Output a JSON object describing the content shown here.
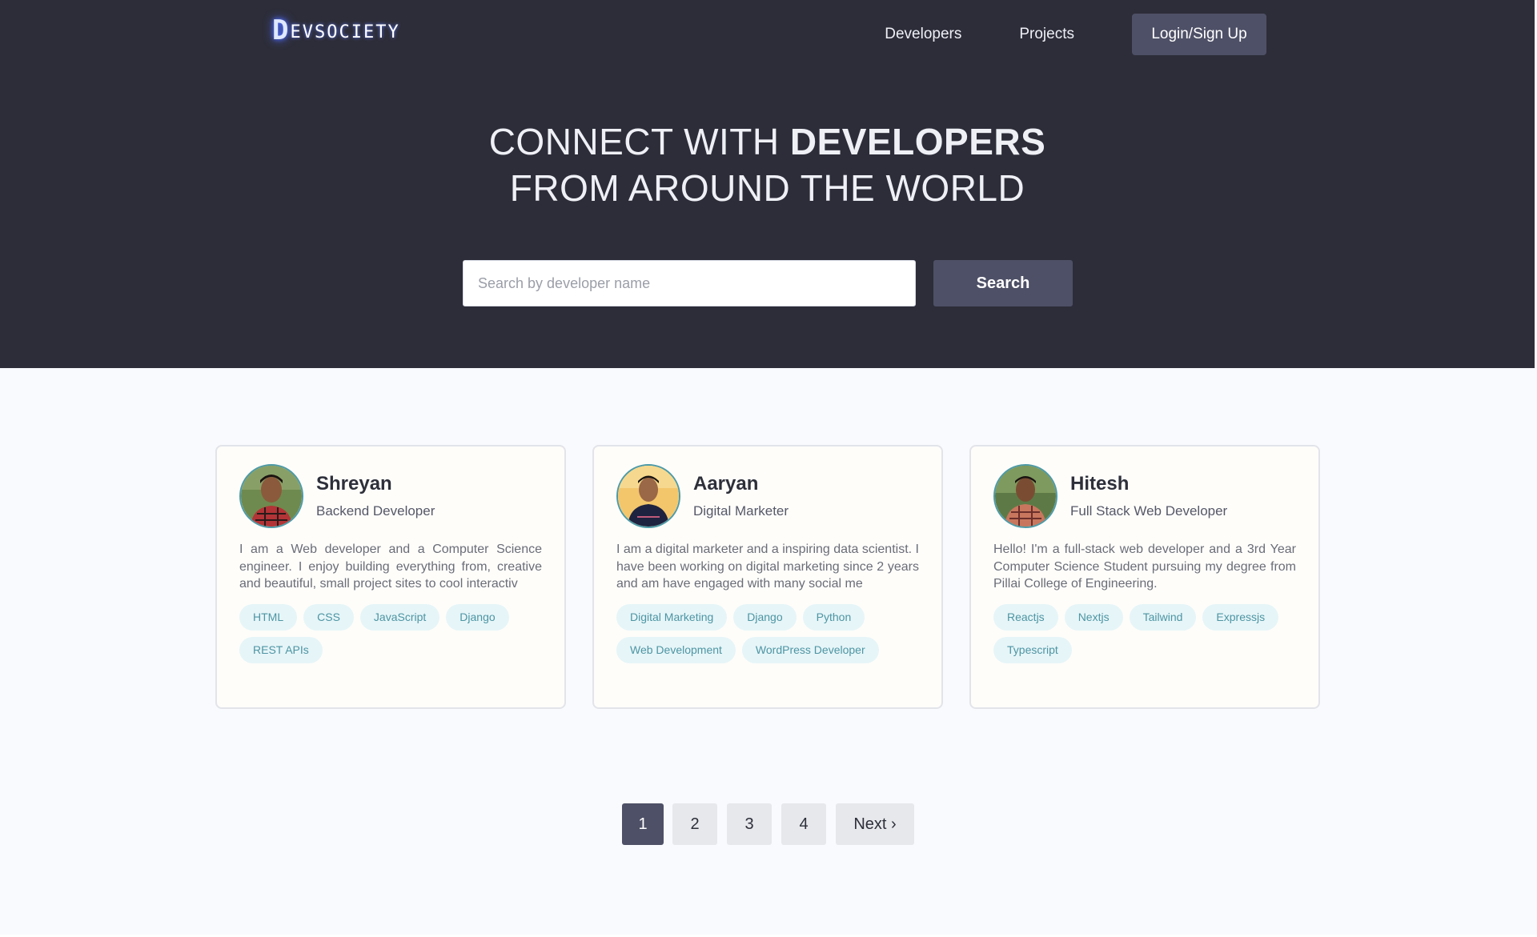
{
  "header": {
    "logo_mark": "D",
    "logo_text": "EVSOCIETY",
    "nav": [
      "Developers",
      "Projects"
    ],
    "login_label": "Login/Sign Up"
  },
  "hero": {
    "line1_plain": "CONNECT WITH ",
    "line1_bold": "DEVELOPERS",
    "line2": "FROM AROUND THE WORLD"
  },
  "search": {
    "placeholder": "Search by developer name",
    "value": "",
    "button_label": "Search"
  },
  "developers": [
    {
      "name": "Shreyan",
      "role": "Backend Developer",
      "bio": "I am a Web developer and a Computer Science engineer. I enjoy building everything from, creative and beautiful, small project sites to cool interactiv",
      "tags": [
        "HTML",
        "CSS",
        "JavaScript",
        "Django",
        "REST APIs"
      ]
    },
    {
      "name": "Aaryan",
      "role": "Digital Marketer",
      "bio": "I am a digital marketer and a inspiring data scientist. I have been working on digital marketing since 2 years and am have engaged with many social me",
      "tags": [
        "Digital Marketing",
        "Django",
        "Python",
        "Web Development",
        "WordPress Developer"
      ]
    },
    {
      "name": "Hitesh",
      "role": "Full Stack Web Developer",
      "bio": "Hello! I'm a full-stack web developer and a 3rd Year Computer Science Student pursuing my degree from Pillai College of Engineering.",
      "tags": [
        "Reactjs",
        "Nextjs",
        "Tailwind",
        "Expressjs",
        "Typescript"
      ]
    }
  ],
  "pagination": {
    "pages": [
      "1",
      "2",
      "3",
      "4"
    ],
    "active": "1",
    "next_label": "Next ›"
  },
  "colors": {
    "hero_bg": "#2d2d39",
    "accent_button": "#4e5067",
    "tag_bg": "#e6f5f8",
    "tag_text": "#4d95a3",
    "page_bg": "#f8fafd"
  }
}
